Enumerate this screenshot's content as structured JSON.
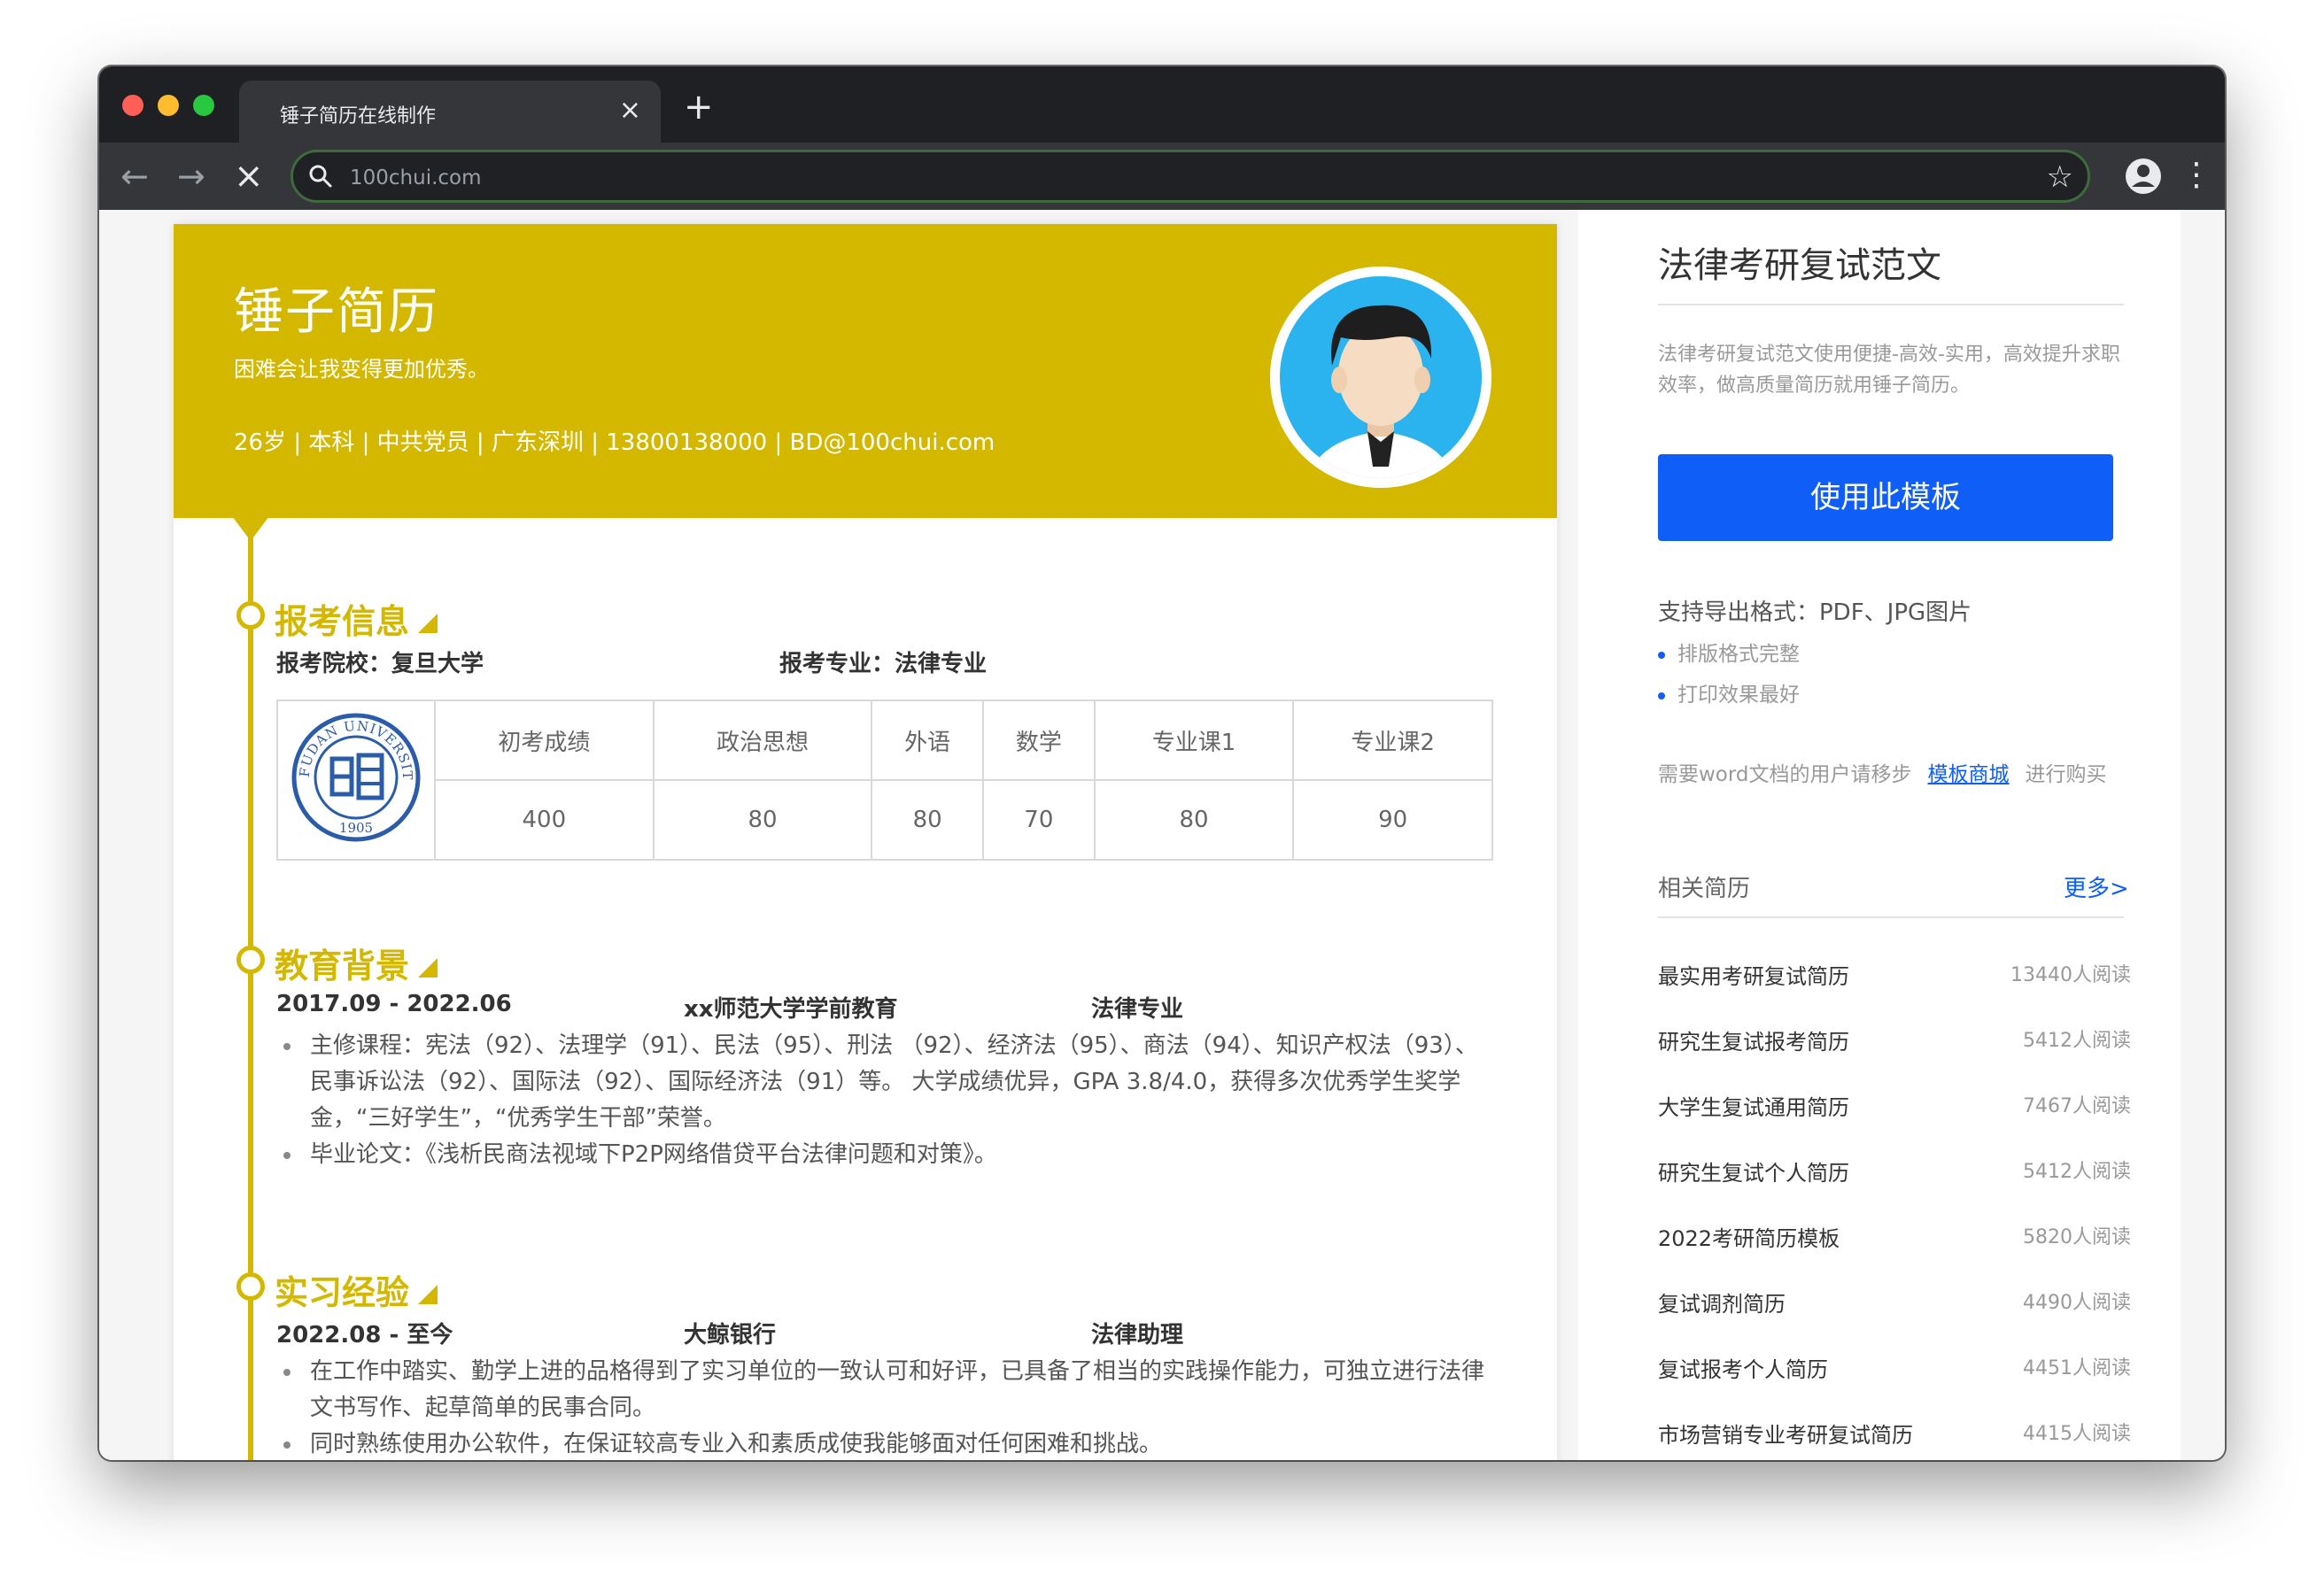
{
  "browser": {
    "tab_title": "锤子简历在线制作",
    "url": "100chui.com"
  },
  "resume": {
    "name": "锤子简历",
    "motto": "困难会让我变得更加优秀。",
    "info": "26岁 | 本科 | 中共党员 | 广东深圳 | 13800138000 | BD@100chui.com",
    "exam": {
      "title": "报考信息",
      "school": "报考院校：复旦大学",
      "major": "报考专业：法律专业",
      "logo_text": "FUDAN UNIVERSITY",
      "logo_year": "1905",
      "headers": [
        "初考成绩",
        "政治思想",
        "外语",
        "数学",
        "专业课1",
        "专业课2"
      ],
      "scores": [
        "400",
        "80",
        "80",
        "70",
        "80",
        "90"
      ]
    },
    "education": {
      "title": "教育背景",
      "period": "2017.09 - 2022.06",
      "school": "xx师范大学学前教育",
      "major": "法律专业",
      "bullets": [
        "主修课程：宪法（92）、法理学（91）、民法（95）、刑法 （92）、经济法（95）、商法（94）、知识产权法（93）、民事诉讼法（92）、国际法（92）、国际经济法（91）等。 大学成绩优异，GPA 3.8/4.0，获得多次优秀学生奖学金，“三好学生”，“优秀学生干部”荣誉。",
        "毕业论文：《浅析民商法视域下P2P网络借贷平台法律问题和对策》。"
      ]
    },
    "internship": {
      "title": "实习经验",
      "period": "2022.08 - 至今",
      "company": "大鲸银行",
      "role": "法律助理",
      "bullets": [
        "在工作中踏实、勤学上进的品格得到了实习单位的一致认可和好评，已具备了相当的实践操作能力，可独立进行法律文书写作、起草简单的民事合同。",
        "同时熟练使用办公软件，在保证较高专业入和素质成使我能够面对任何困难和挑战。"
      ]
    }
  },
  "sidebar": {
    "title": "法律考研复试范文",
    "description": "法律考研复试范文使用便捷-高效-实用，高效提升求职效率，做高质量简历就用锤子简历。",
    "use_button": "使用此模板",
    "formats": "支持导出格式：PDF、JPG图片",
    "features": [
      "排版格式完整",
      "打印效果最好"
    ],
    "word_prefix": "需要word文档的用户请移步",
    "word_link": "模板商城",
    "word_suffix": "进行购买",
    "related_title": "相关简历",
    "more": "更多>",
    "related": [
      {
        "title": "最实用考研复试简历",
        "reads": "13440人阅读"
      },
      {
        "title": "研究生复试报考简历",
        "reads": "5412人阅读"
      },
      {
        "title": "大学生复试通用简历",
        "reads": "7467人阅读"
      },
      {
        "title": "研究生复试个人简历",
        "reads": "5412人阅读"
      },
      {
        "title": "2022考研简历模板",
        "reads": "5820人阅读"
      },
      {
        "title": "复试调剂简历",
        "reads": "4490人阅读"
      },
      {
        "title": "复试报考个人简历",
        "reads": "4451人阅读"
      },
      {
        "title": "市场营销专业考研复试简历",
        "reads": "4415人阅读"
      }
    ]
  },
  "colors": {
    "accent_yellow": "#d4b800",
    "primary_blue": "#0f5ef7",
    "logo_blue": "#2a5caa"
  }
}
